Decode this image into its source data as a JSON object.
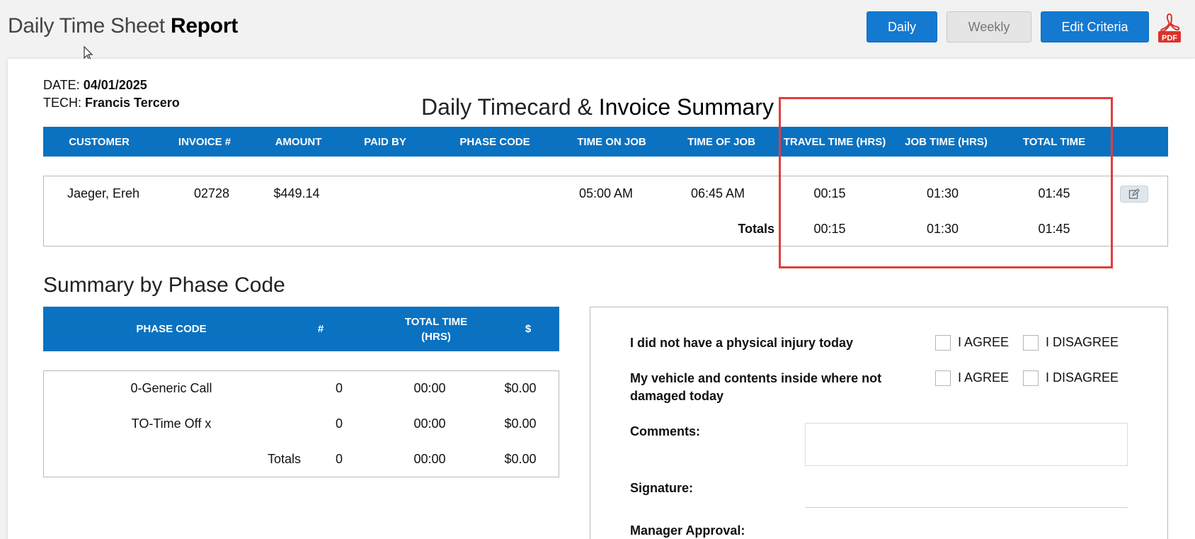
{
  "header": {
    "title_light": "Daily Time Sheet",
    "title_bold": "Report",
    "buttons": {
      "daily": "Daily",
      "weekly": "Weekly",
      "edit": "Edit Criteria"
    },
    "pdf_label": "PDF"
  },
  "meta": {
    "date_label": "DATE:",
    "date_value": "04/01/2025",
    "tech_label": "TECH:",
    "tech_value": "Francis Tercero"
  },
  "summary": {
    "title_light": "Daily Timecard &",
    "title_bold": "Invoice Summary",
    "columns": [
      "CUSTOMER",
      "INVOICE #",
      "AMOUNT",
      "PAID BY",
      "PHASE CODE",
      "TIME ON JOB",
      "TIME OF JOB",
      "TRAVEL TIME (HRS)",
      "JOB TIME (HRS)",
      "TOTAL TIME"
    ],
    "rows": [
      {
        "customer": "Jaeger, Ereh",
        "invoice": "02728",
        "amount": "$449.14",
        "paid_by": "",
        "phase_code": "",
        "time_on_job": "05:00 AM",
        "time_of_job": "06:45 AM",
        "travel": "00:15",
        "job": "01:30",
        "total": "01:45"
      }
    ],
    "totals": {
      "label": "Totals",
      "travel": "00:15",
      "job": "01:30",
      "total": "01:45"
    }
  },
  "phase": {
    "title": "Summary by Phase Code",
    "columns": [
      "PHASE CODE",
      "#",
      "TOTAL TIME (HRS)",
      "$"
    ],
    "rows": [
      {
        "code": "0-Generic Call",
        "count": "0",
        "time": "00:00",
        "amount": "$0.00"
      },
      {
        "code": "TO-Time Off x",
        "count": "0",
        "time": "00:00",
        "amount": "$0.00"
      }
    ],
    "totals": {
      "label": "Totals",
      "count": "0",
      "time": "00:00",
      "amount": "$0.00"
    }
  },
  "survey": {
    "q1": "I did not have a physical injury today",
    "q2_line1": "My vehicle and contents inside where not",
    "q2_line2": "damaged today",
    "agree": "I AGREE",
    "disagree": "I DISAGREE",
    "comments_label": "Comments:",
    "signature_label": "Signature:",
    "manager_label": "Manager Approval:"
  }
}
